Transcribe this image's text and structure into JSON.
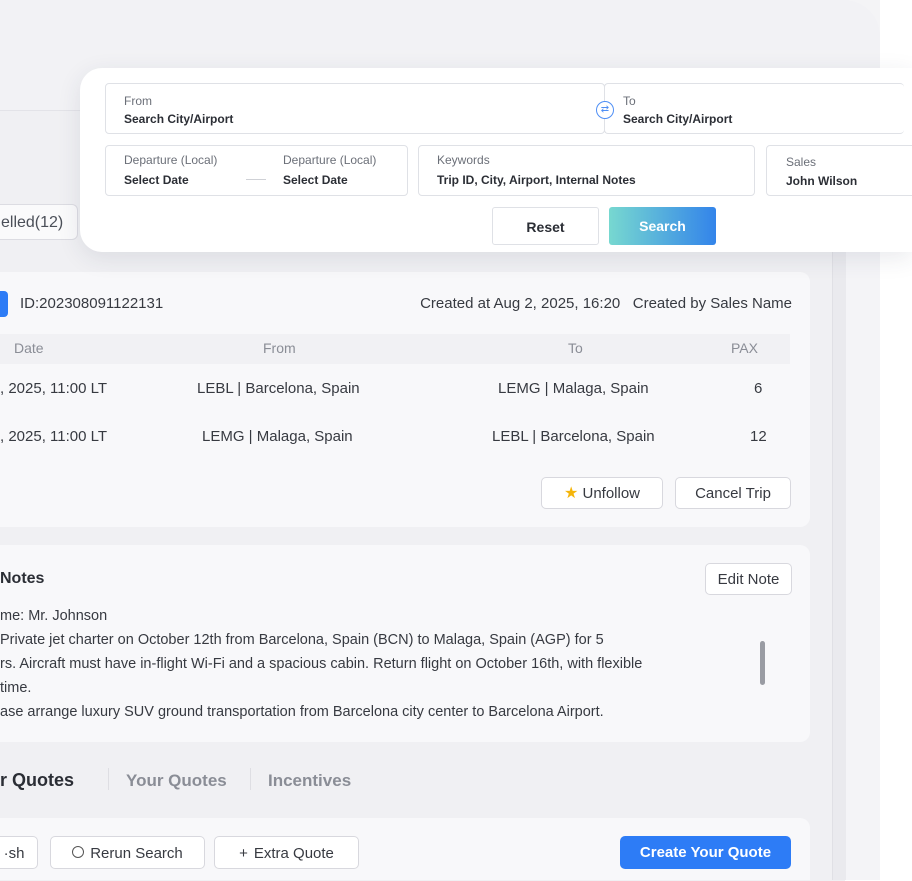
{
  "filter": {
    "from_label": "From",
    "from_placeholder": "Search City/Airport",
    "to_label": "To",
    "to_placeholder": "Search City/Airport",
    "departure1_label": "Departure (Local)",
    "departure1_value": "Select Date",
    "departure2_label": "Departure (Local)",
    "departure2_value": "Select Date",
    "keywords_label": "Keywords",
    "keywords_placeholder": "Trip ID, City, Airport, Internal Notes",
    "sales_label": "Sales",
    "sales_value": "John Wilson",
    "reset_label": "Reset",
    "search_label": "Search",
    "swap_icon": "⇄"
  },
  "status_tab": {
    "label": "elled(12)"
  },
  "trip": {
    "id": "ID:202308091122131",
    "created": "Created at Aug 2, 2025, 16:20   Created by Sales Name",
    "columns": [
      "Date",
      "From",
      "To",
      "PAX"
    ],
    "rows": [
      {
        "date": ", 2025, 11:00 LT",
        "from": "LEBL | Barcelona, Spain",
        "to": "LEMG | Malaga, Spain",
        "pax": "6"
      },
      {
        "date": ", 2025, 11:00 LT",
        "from": "LEMG | Malaga, Spain",
        "to": "LEBL | Barcelona, Spain",
        "pax": "12"
      }
    ],
    "unfollow_label": "Unfollow",
    "cancel_label": "Cancel Trip"
  },
  "notes": {
    "title": "Notes",
    "edit_label": "Edit Note",
    "lines": [
      "me: Mr. Johnson",
      "Private jet charter on October 12th from Barcelona, Spain (BCN) to Malaga, Spain (AGP) for 5",
      "rs. Aircraft must have in-flight Wi-Fi and a spacious cabin. Return flight on October 16th, with flexible",
      " time.",
      "ase arrange luxury SUV ground transportation from Barcelona city center to Barcelona Airport."
    ]
  },
  "quote_tabs": [
    "r Quotes",
    "Your Quotes",
    "Incentives"
  ],
  "actions": {
    "refresh_label": "·sh",
    "rerun_label": "Rerun Search",
    "extra_label": "Extra Quote",
    "create_label": "Create Your Quote"
  },
  "colors": {
    "accent": "#2d7cf6",
    "star": "#f5b50a"
  }
}
